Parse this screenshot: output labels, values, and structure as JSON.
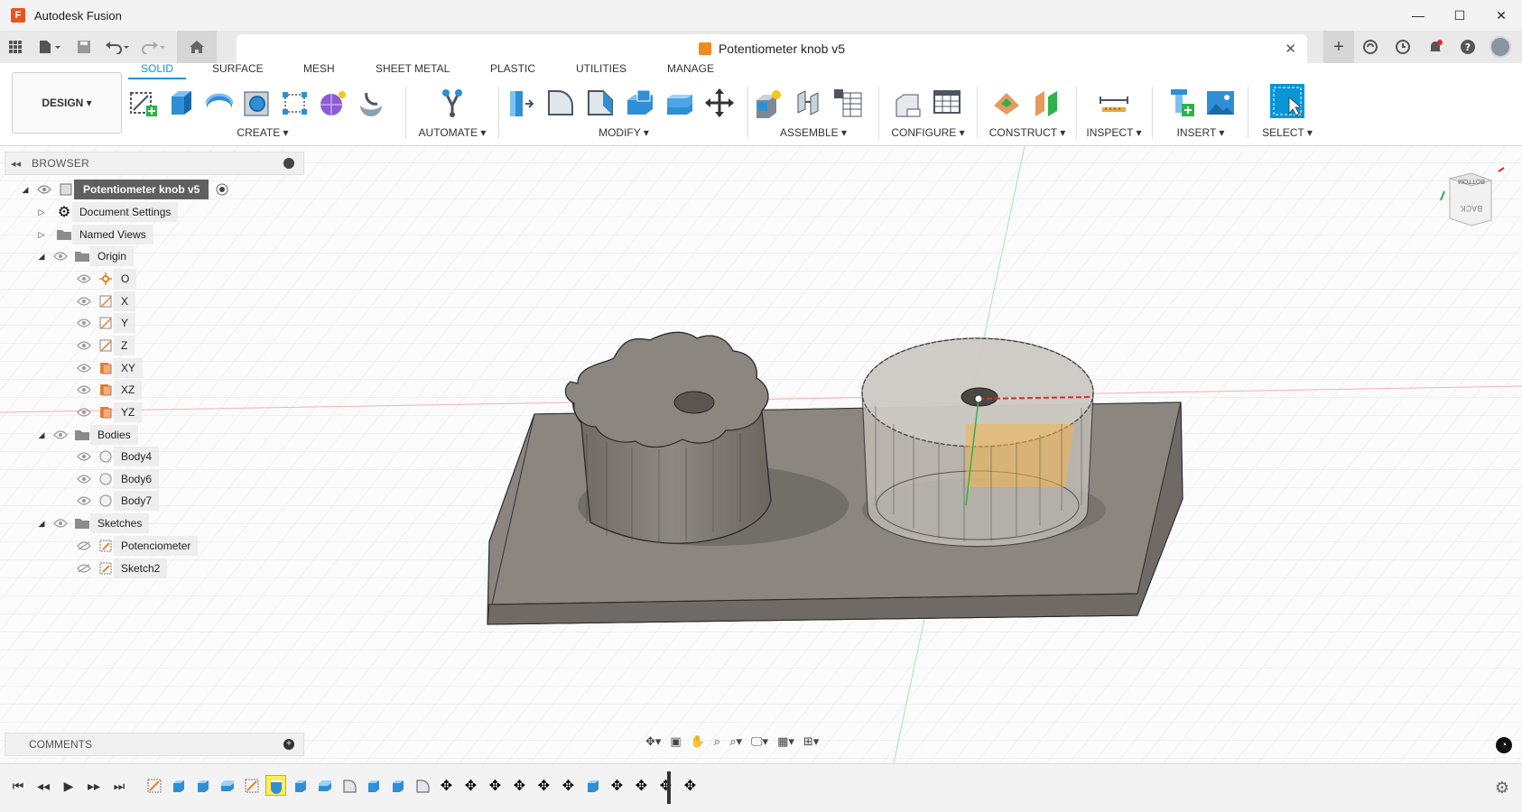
{
  "app": {
    "title": "Autodesk Fusion",
    "logo_letter": "F"
  },
  "window_controls": {
    "minimize": "—",
    "maximize": "☐",
    "close": "✕"
  },
  "document": {
    "tab_title": "Potentiometer knob v5",
    "close": "✕"
  },
  "ribbon": {
    "workspace": "DESIGN ▾",
    "tabs": [
      "SOLID",
      "SURFACE",
      "MESH",
      "SHEET METAL",
      "PLASTIC",
      "UTILITIES",
      "MANAGE"
    ],
    "active_tab": "SOLID",
    "groups": {
      "create": "CREATE ▾",
      "automate": "AUTOMATE ▾",
      "modify": "MODIFY ▾",
      "assemble": "ASSEMBLE ▾",
      "configure": "CONFIGURE ▾",
      "construct": "CONSTRUCT ▾",
      "inspect": "INSPECT ▾",
      "insert": "INSERT ▾",
      "select": "SELECT ▾"
    }
  },
  "browser": {
    "title": "BROWSER",
    "root": "Potentiometer knob v5",
    "document_settings": "Document Settings",
    "named_views": "Named Views",
    "origin": "Origin",
    "origin_items": [
      "O",
      "X",
      "Y",
      "Z",
      "XY",
      "XZ",
      "YZ"
    ],
    "bodies": "Bodies",
    "body_items": [
      "Body4",
      "Body6",
      "Body7"
    ],
    "sketches": "Sketches",
    "sketch_items": [
      "Potenciometer",
      "Sketch2"
    ]
  },
  "comments": {
    "title": "COMMENTS"
  },
  "viewcube": {
    "top": "BOTTOM",
    "face": "BACK"
  },
  "colors": {
    "accent": "#0696d7",
    "brand": "#e8541e",
    "model_gray": "#8a8580",
    "highlight": "#ffee55"
  }
}
